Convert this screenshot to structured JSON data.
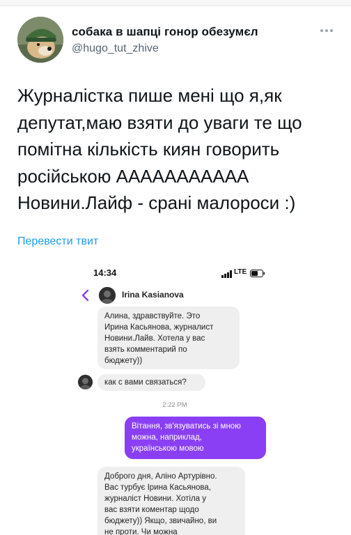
{
  "tweet": {
    "display_name": "собака в шапці гонор обезумєл",
    "handle": "@hugo_tut_zhive",
    "text_lines": [
      "Журналістка пише мені що я,як",
      "депутат,маю взяти до уваги те що",
      "помітна кількість киян говорить",
      "російською ААААААААААА",
      "Новини.Лайф - срані малороси :)"
    ],
    "translate_label": "Перевести твит",
    "avatar_icon": "dog-in-hat-avatar",
    "more_icon": "more-dots-icon"
  },
  "phone_screenshot": {
    "status_bar": {
      "time": "14:34",
      "network": "LTE",
      "signal_icon": "signal-bars-icon",
      "battery_icon": "battery-icon"
    },
    "header": {
      "back_icon": "chevron-left-icon",
      "contact_name": "Irina  Kasianova",
      "accent_color": "#8a3ff5"
    },
    "messages": [
      {
        "direction": "incoming",
        "lines": [
          "Алина, здравствуйте. Это",
          "Ирина Касьянова, журналист",
          "Новини.Лайв. Хотела у вас",
          "взять комментарий по",
          "бюджету))"
        ]
      },
      {
        "direction": "incoming",
        "lines": [
          "как с вами связаться?"
        ]
      },
      {
        "direction": "outgoing",
        "lines": [
          "Вітання, зв'язуватись зі мною",
          "можна, наприклад,",
          "українською мовою"
        ]
      },
      {
        "direction": "incoming",
        "lines": [
          "Доброго дня, Аліно Артурівно.",
          "Вас турбує Ірина Касьянова,",
          "журналіст Новини. Хотіла у",
          "вас взяти коментар щодо",
          "бюджету)) Якщо, звичайно, ви",
          "не проти. Чи можна"
        ]
      }
    ],
    "timestamp": "2:22 PM"
  }
}
